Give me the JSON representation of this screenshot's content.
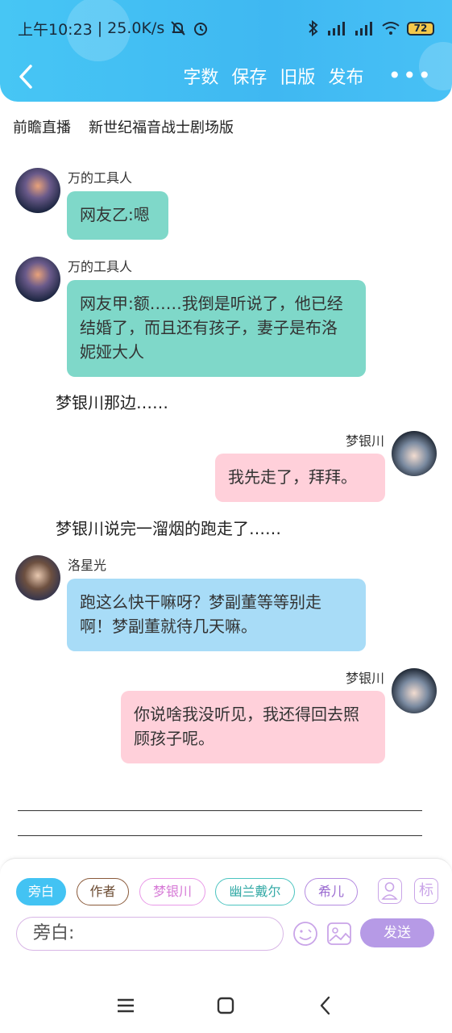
{
  "status_bar": {
    "time": "上午10:23",
    "speed": "25.0K/s",
    "battery": "72"
  },
  "header": {
    "actions": [
      "字数",
      "保存",
      "旧版",
      "发布"
    ],
    "more": "•••"
  },
  "subtitle": {
    "left": "前瞻直播",
    "right": "新世纪福音战士剧场版"
  },
  "messages": [
    {
      "name": "万的工具人",
      "text": "网友乙:嗯"
    },
    {
      "name": "万的工具人",
      "text": "网友甲:额……我倒是听说了，他已经结婚了，而且还有孩子，妻子是布洛妮娅大人"
    },
    {
      "narration": "梦银川那边……"
    },
    {
      "name": "梦银川",
      "text": "我先走了，拜拜。"
    },
    {
      "narration": "梦银川说完一溜烟的跑走了……"
    },
    {
      "name": "洛星光",
      "text": "跑这么快干嘛呀？梦副董等等别走啊！梦副董就待几天嘛。"
    },
    {
      "name": "梦银川",
      "text": "你说啥我没听见，我还得回去照顾孩子呢。"
    }
  ],
  "compose": {
    "chips": [
      "旁白",
      "作者",
      "梦银川",
      "幽兰戴尔",
      "希儿"
    ],
    "tag_label": "标",
    "input_value": "旁白:",
    "send_label": "发送"
  },
  "colors": {
    "header_bg": "#3fb8f2",
    "green_bubble": "#7fd8c9",
    "pink_bubble": "#ffd0da",
    "blue_bubble": "#a8dcf7",
    "send_button": "#b69ae6"
  }
}
